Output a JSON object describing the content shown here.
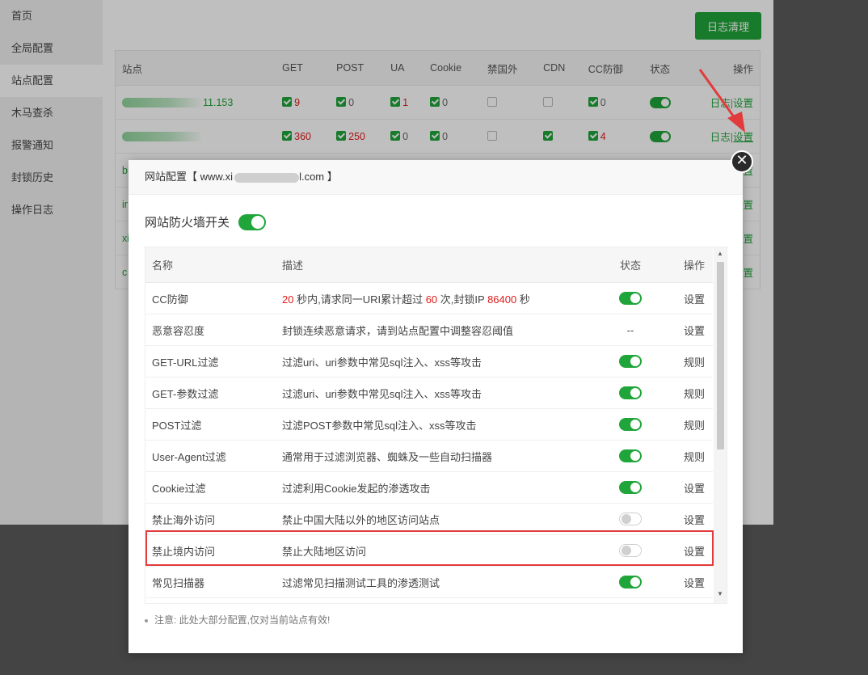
{
  "sidebar": {
    "items": [
      {
        "label": "首页"
      },
      {
        "label": "全局配置"
      },
      {
        "label": "站点配置"
      },
      {
        "label": "木马查杀"
      },
      {
        "label": "报警通知"
      },
      {
        "label": "封锁历史"
      },
      {
        "label": "操作日志"
      }
    ],
    "active_index": 2
  },
  "main": {
    "log_clear_label": "日志清理",
    "site_table": {
      "headers": [
        "站点",
        "GET",
        "POST",
        "UA",
        "Cookie",
        "禁国外",
        "CDN",
        "CC防御",
        "状态",
        "操作"
      ],
      "rows": [
        {
          "site_suffix": "11.153",
          "get": "9",
          "post": "0",
          "ua": "1",
          "cookie": "0",
          "cc": "0",
          "log_label": "日志",
          "sep": "|",
          "set_label": "设置"
        },
        {
          "site_suffix": "",
          "get": "360",
          "post": "250",
          "ua": "0",
          "cookie": "0",
          "cc": "4",
          "log_label": "日志",
          "sep": "|",
          "set_label": "设置"
        }
      ],
      "peek_rows": [
        {
          "first_chars": "b",
          "op_label": "置"
        },
        {
          "first_chars": "ir",
          "op_label": "置"
        },
        {
          "first_chars": "xi",
          "op_label": "置"
        },
        {
          "first_chars": "c",
          "op_label": "置"
        }
      ]
    }
  },
  "dialog": {
    "title_prefix": "网站配置【 www.xi",
    "title_suffix": "l.com 】",
    "close_glyph": "✕",
    "firewall_label": "网站防火墙开关",
    "firewall_on": true,
    "columns": {
      "name": "名称",
      "desc": "描述",
      "status": "状态",
      "action": "操作"
    },
    "cc_desc": {
      "v1": "20",
      "t1": " 秒内,请求同一URI累计超过 ",
      "v2": "60",
      "t2": " 次,封锁IP ",
      "v3": "86400",
      "t3": " 秒"
    },
    "rules": [
      {
        "name": "CC防御",
        "status": "on",
        "action": "设置"
      },
      {
        "name": "恶意容忍度",
        "desc": "封锁连续恶意请求，请到站点配置中调整容忍阈值",
        "status_text": "--",
        "action": "设置"
      },
      {
        "name": "GET-URL过滤",
        "desc": "过滤uri、uri参数中常见sql注入、xss等攻击",
        "status": "on",
        "action": "规则"
      },
      {
        "name": "GET-参数过滤",
        "desc": "过滤uri、uri参数中常见sql注入、xss等攻击",
        "status": "on",
        "action": "规则"
      },
      {
        "name": "POST过滤",
        "desc": "过滤POST参数中常见sql注入、xss等攻击",
        "status": "on",
        "action": "规则"
      },
      {
        "name": "User-Agent过滤",
        "desc": "通常用于过滤浏览器、蜘蛛及一些自动扫描器",
        "status": "on",
        "action": "规则"
      },
      {
        "name": "Cookie过滤",
        "desc": "过滤利用Cookie发起的渗透攻击",
        "status": "on",
        "action": "设置"
      },
      {
        "name": "禁止海外访问",
        "desc": "禁止中国大陆以外的地区访问站点",
        "status": "off",
        "action": "设置"
      },
      {
        "name": "禁止境内访问",
        "desc": "禁止大陆地区访问",
        "status": "off",
        "action": "设置"
      },
      {
        "name": "常见扫描器",
        "desc": "过滤常见扫描测试工具的渗透测试",
        "status": "on",
        "action": "设置"
      }
    ],
    "note": "注意: 此处大部分配置,仅对当前站点有效!"
  },
  "colors": {
    "accent": "#20a53a",
    "highlight": "#e23b3b",
    "value_red": "#e01b1b"
  }
}
